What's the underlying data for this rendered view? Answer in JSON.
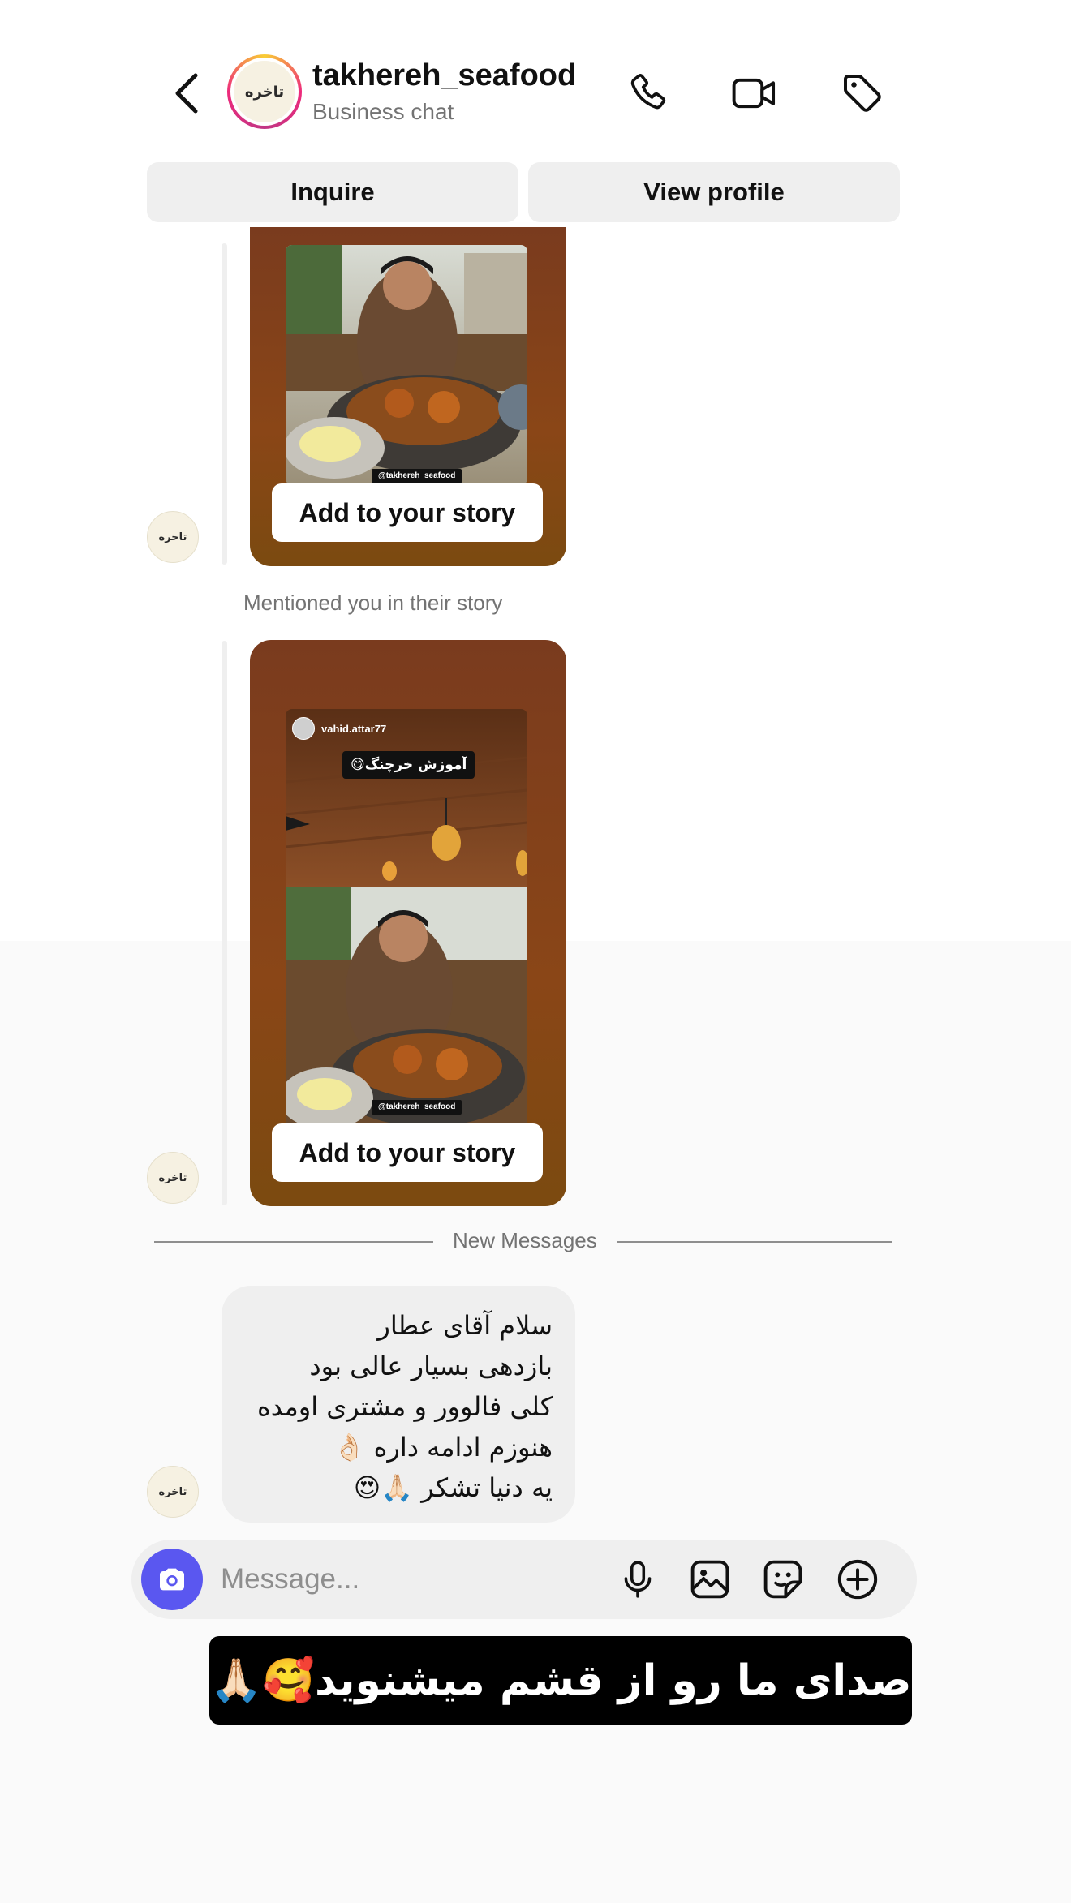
{
  "header": {
    "username": "takhereh_seafood",
    "subtitle": "Business chat",
    "logo_text": "تاخره",
    "inquire_label": "Inquire",
    "view_profile_label": "View profile"
  },
  "messages": {
    "story1": {
      "tag": "@takhereh_seafood",
      "button_label": "Add to your story"
    },
    "mention_text": "Mentioned you in their story",
    "story2": {
      "story_user": "vahid.attar77",
      "story_caption": "آموزش خرچنگ😋",
      "tag": "@takhereh_seafood",
      "button_label": "Add to your story"
    },
    "new_messages_label": "New Messages",
    "bubble_lines": [
      "سلام آقای عطار",
      "بازدهی بسیار عالی بود",
      "کلی فالوور و مشتری اومده",
      "هنوزم ادامه داره 👌🏻",
      "یه دنیا تشکر 🙏🏻😍"
    ]
  },
  "composer": {
    "placeholder": "Message..."
  },
  "caption": {
    "text": "صدای ما رو از قشم میشنوید🥰🙏🏻"
  },
  "colors": {
    "accent": "#5a57f0",
    "story_bg": "#7a3b1e",
    "bubble_bg": "#efefef"
  }
}
